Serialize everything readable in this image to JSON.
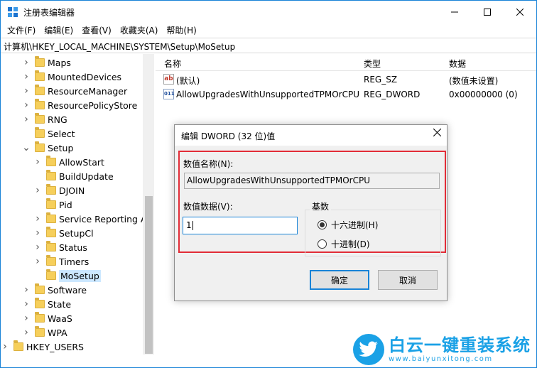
{
  "window": {
    "title": "注册表编辑器",
    "accent": "#1883d7"
  },
  "menu": [
    "文件(F)",
    "编辑(E)",
    "查看(V)",
    "收藏夹(A)",
    "帮助(H)"
  ],
  "address": "计算机\\HKEY_LOCAL_MACHINE\\SYSTEM\\Setup\\MoSetup",
  "tree": {
    "items": [
      {
        "label": "Maps",
        "expander": "chevron-right"
      },
      {
        "label": "MountedDevices",
        "expander": "chevron-right"
      },
      {
        "label": "ResourceManager",
        "expander": "chevron-right"
      },
      {
        "label": "ResourcePolicyStore",
        "expander": "chevron-right"
      },
      {
        "label": "RNG",
        "expander": "chevron-right"
      },
      {
        "label": "Select",
        "expander": "none"
      },
      {
        "label": "Setup",
        "expander": "chevron-down"
      },
      {
        "label": "AllowStart",
        "expander": "chevron-right"
      },
      {
        "label": "BuildUpdate",
        "expander": "none"
      },
      {
        "label": "DJOIN",
        "expander": "chevron-right"
      },
      {
        "label": "Pid",
        "expander": "none"
      },
      {
        "label": "Service Reporting AP",
        "expander": "chevron-right"
      },
      {
        "label": "SetupCl",
        "expander": "chevron-right"
      },
      {
        "label": "Status",
        "expander": "chevron-right"
      },
      {
        "label": "Timers",
        "expander": "chevron-right"
      },
      {
        "label": "MoSetup",
        "expander": "none",
        "selected": true
      },
      {
        "label": "Software",
        "expander": "chevron-right"
      },
      {
        "label": "State",
        "expander": "chevron-right"
      },
      {
        "label": "WaaS",
        "expander": "chevron-right"
      },
      {
        "label": "WPA",
        "expander": "chevron-right"
      },
      {
        "label": "HKEY_USERS",
        "expander": "chevron-right"
      }
    ]
  },
  "list": {
    "headers": {
      "name": "名称",
      "type": "类型",
      "data": "数据"
    },
    "rows": [
      {
        "icon": "string-value-icon",
        "icon_text": "ab",
        "name": "(默认)",
        "type": "REG_SZ",
        "data": "(数值未设置)"
      },
      {
        "icon": "dword-value-icon",
        "icon_text": "011\n110",
        "name": "AllowUpgradesWithUnsupportedTPMOrCPU",
        "type": "REG_DWORD",
        "data": "0x00000000 (0)"
      }
    ]
  },
  "dialog": {
    "title": "编辑 DWORD (32 位)值",
    "name_label": "数值名称(N):",
    "name_value": "AllowUpgradesWithUnsupportedTPMOrCPU",
    "data_label": "数值数据(V):",
    "data_value": "1",
    "base_label": "基数",
    "hex_label": "十六进制(H)",
    "dec_label": "十进制(D)",
    "base_selected": "hex",
    "ok_label": "确定",
    "cancel_label": "取消",
    "highlight_color": "#e22c37"
  },
  "watermark": {
    "brand": "白云一键重装系统",
    "url": "www.baiyunxitong.com",
    "color": "#1aa1e6"
  }
}
